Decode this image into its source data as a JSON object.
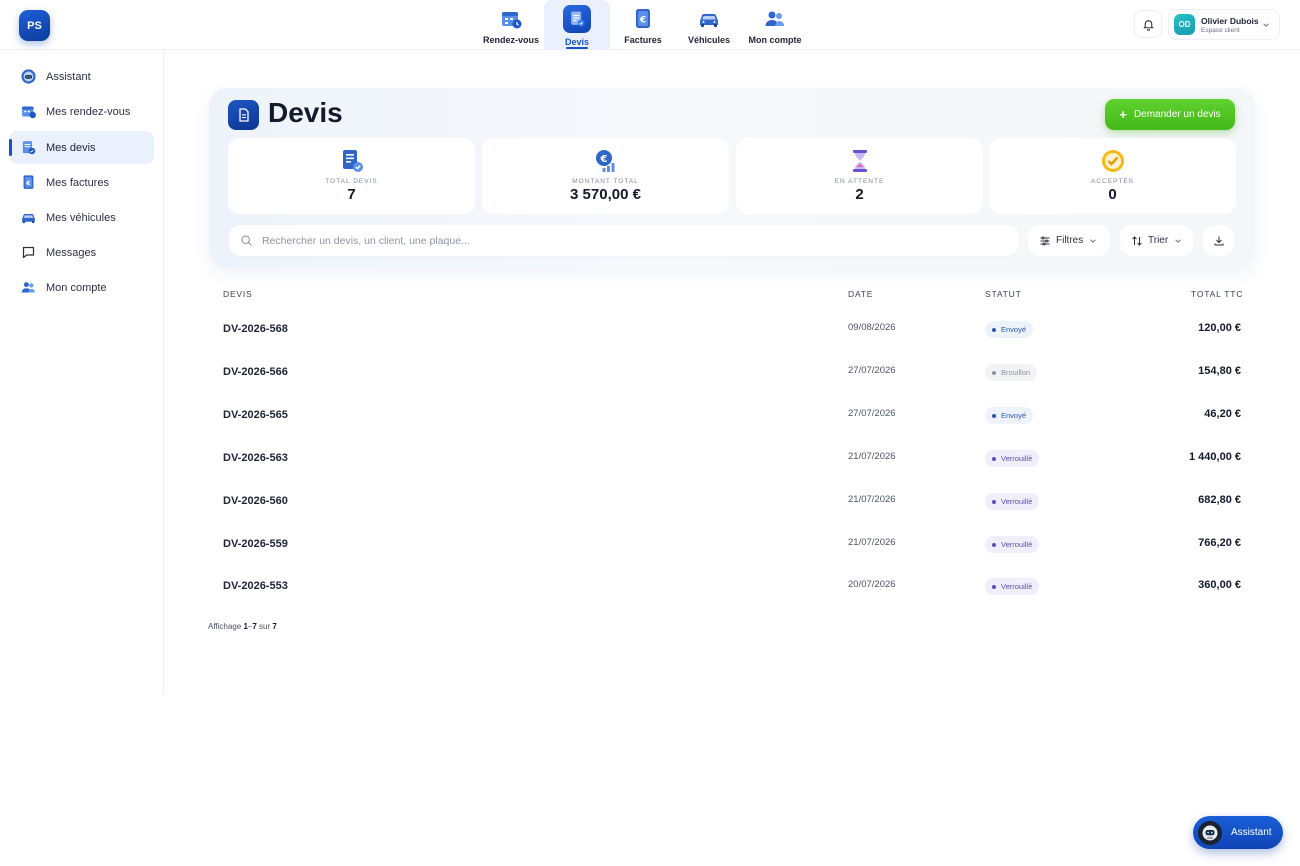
{
  "app": {
    "logo_text": "PS"
  },
  "topnav": [
    {
      "label": "Rendez-vous",
      "icon": "calendar-icon"
    },
    {
      "label": "Devis",
      "icon": "quote-document-icon",
      "active": true
    },
    {
      "label": "Factures",
      "icon": "invoice-euro-icon"
    },
    {
      "label": "Véhicules",
      "icon": "car-icon"
    },
    {
      "label": "Mon compte",
      "icon": "users-icon"
    }
  ],
  "user": {
    "initials": "OD",
    "name": "Olivier Dubois",
    "role": "Espace client"
  },
  "sidebar": [
    {
      "label": "Assistant",
      "icon": "assistant-icon"
    },
    {
      "label": "Mes rendez-vous",
      "icon": "calendar-icon"
    },
    {
      "label": "Mes devis",
      "icon": "quote-document-icon",
      "active": true
    },
    {
      "label": "Mes factures",
      "icon": "invoice-euro-icon"
    },
    {
      "label": "Mes véhicules",
      "icon": "car-icon"
    },
    {
      "label": "Messages",
      "icon": "message-icon"
    },
    {
      "label": "Mon compte",
      "icon": "users-icon"
    }
  ],
  "page": {
    "title": "Devis",
    "cta_label": "Demander un devis"
  },
  "stats": [
    {
      "label": "TOTAL DEVIS",
      "value": "7",
      "icon": "documents-check-icon"
    },
    {
      "label": "MONTANT TOTAL",
      "value": "3 570,00 €",
      "icon": "euro-chart-icon"
    },
    {
      "label": "EN ATTENTE",
      "value": "2",
      "icon": "hourglass-icon"
    },
    {
      "label": "ACCEPTÉS",
      "value": "0",
      "icon": "check-badge-icon"
    }
  ],
  "search": {
    "placeholder": "Rechercher un devis, un client, une plaque..."
  },
  "filters": {
    "filter_label": "Filtres",
    "sort_label": "Trier"
  },
  "table": {
    "headers": {
      "id": "DEVIS",
      "date": "DATE",
      "status": "STATUT",
      "total": "TOTAL TTC"
    },
    "rows": [
      {
        "id": "DV-2026-568",
        "date": "09/08/2026",
        "status": "Envoyé",
        "total": "120,00 €"
      },
      {
        "id": "DV-2026-566",
        "date": "27/07/2026",
        "status": "Brouillon",
        "total": "154,80 €"
      },
      {
        "id": "DV-2026-565",
        "date": "27/07/2026",
        "status": "Envoyé",
        "total": "46,20 €"
      },
      {
        "id": "DV-2026-563",
        "date": "21/07/2026",
        "status": "Verrouillé",
        "total": "1 440,00 €"
      },
      {
        "id": "DV-2026-560",
        "date": "21/07/2026",
        "status": "Verrouillé",
        "total": "682,80 €"
      },
      {
        "id": "DV-2026-559",
        "date": "21/07/2026",
        "status": "Verrouillé",
        "total": "766,20 €"
      },
      {
        "id": "DV-2026-553",
        "date": "20/07/2026",
        "status": "Verrouillé",
        "total": "360,00 €"
      }
    ]
  },
  "pager": {
    "prefix": "Affichage",
    "from": "1",
    "sep": "–",
    "to": "7",
    "mid": "sur",
    "total": "7"
  },
  "fab": {
    "label": "Assistant"
  },
  "colors": {
    "primary": "#1651c9",
    "cta": "#4fc520",
    "sent": "#2c56b8",
    "draft": "#8a92a3",
    "locked": "#5b4fb2"
  }
}
